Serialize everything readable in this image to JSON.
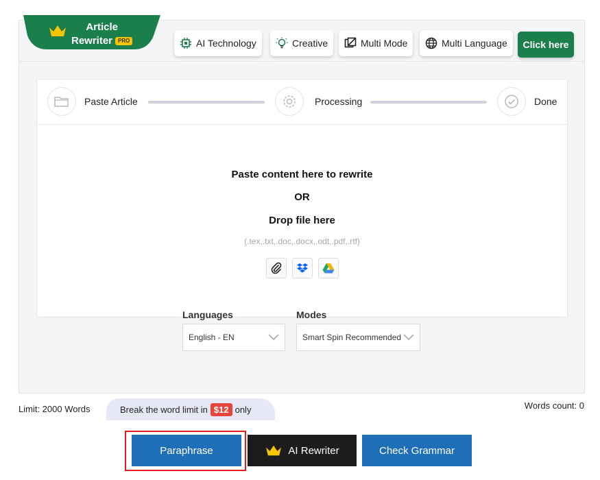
{
  "brand": {
    "title_line1": "Article",
    "title_line2": "Rewriter",
    "badge": "PRO"
  },
  "features": [
    {
      "label": "AI Technology",
      "icon": "chip-icon"
    },
    {
      "label": "Creative",
      "icon": "lightbulb-icon"
    },
    {
      "label": "Multi Mode",
      "icon": "layers-icon"
    },
    {
      "label": "Multi Language",
      "icon": "globe-icon"
    }
  ],
  "cta_label": "Click here",
  "steps": [
    {
      "label": "Paste Article",
      "icon": "folder-icon"
    },
    {
      "label": "Processing",
      "icon": "gear-icon"
    },
    {
      "label": "Done",
      "icon": "check-icon"
    }
  ],
  "drop": {
    "line1": "Paste content here to rewrite",
    "line2": "OR",
    "line3": "Drop file here",
    "formats": "(.tex,.txt,.doc,.docx,.odt,.pdf,.rtf)",
    "sources": [
      "attach-icon",
      "dropbox-icon",
      "google-drive-icon"
    ]
  },
  "languages": {
    "label": "Languages",
    "value": "English - EN"
  },
  "modes": {
    "label": "Modes",
    "value": "Smart Spin Recommended"
  },
  "limit_text": "Limit: 2000 Words",
  "break_limit": {
    "prefix": "Break the word limit in",
    "price": "$12",
    "suffix": "only"
  },
  "words_count": "Words count: 0",
  "buttons": {
    "paraphrase": "Paraphrase",
    "ai_rewriter": "AI Rewriter",
    "check_grammar": "Check Grammar"
  },
  "colors": {
    "brand_green": "#1a7f4b",
    "primary_blue": "#1f6fb8",
    "dark": "#1c1c1c",
    "price_red": "#e7453b",
    "highlight_red": "#e21b1b"
  }
}
